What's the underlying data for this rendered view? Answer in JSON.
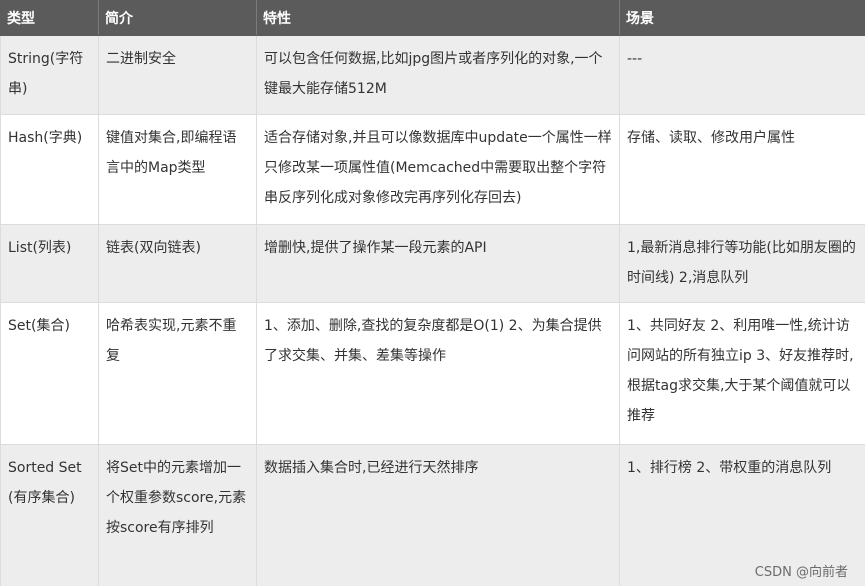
{
  "table": {
    "headers": [
      "类型",
      "简介",
      "特性",
      "场景"
    ],
    "rows": [
      {
        "type": "String(字符串)",
        "intro": "二进制安全",
        "features": "可以包含任何数据,比如jpg图片或者序列化的对象,一个键最大能存储512M",
        "scenarios": "---"
      },
      {
        "type": "Hash(字典)",
        "intro": "键值对集合,即编程语言中的Map类型",
        "features": "适合存储对象,并且可以像数据库中update一个属性一样只修改某一项属性值(Memcached中需要取出整个字符串反序列化成对象修改完再序列化存回去)",
        "scenarios": "存储、读取、修改用户属性"
      },
      {
        "type": "List(列表)",
        "intro": "链表(双向链表)",
        "features": "增删快,提供了操作某一段元素的API",
        "scenarios": "1,最新消息排行等功能(比如朋友圈的时间线) 2,消息队列"
      },
      {
        "type": "Set(集合)",
        "intro": "哈希表实现,元素不重复",
        "features": "1、添加、删除,查找的复杂度都是O(1) 2、为集合提供了求交集、并集、差集等操作",
        "scenarios": "1、共同好友 2、利用唯一性,统计访问网站的所有独立ip 3、好友推荐时,根据tag求交集,大于某个阈值就可以推荐"
      },
      {
        "type": "Sorted Set(有序集合)",
        "intro": "将Set中的元素增加一个权重参数score,元素按score有序排列",
        "features": "数据插入集合时,已经进行天然排序",
        "scenarios": "1、排行榜 2、带权重的消息队列"
      }
    ]
  },
  "watermark": "CSDN @向前者",
  "colors": {
    "header_bg": "#5b5b5b",
    "header_text": "#ffffff",
    "row_alt_bg": "#ededed",
    "row_bg": "#ffffff",
    "text": "#333333",
    "border": "#dcdcdc"
  }
}
